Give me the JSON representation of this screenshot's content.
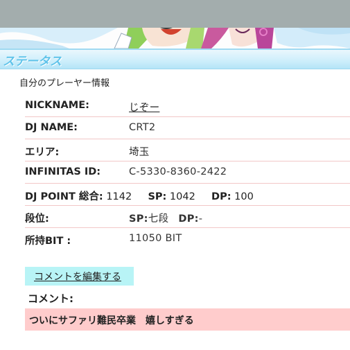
{
  "section": {
    "title": "ステータス"
  },
  "subtitle": "自分のプレーヤー情報",
  "profile": {
    "nickname_label": "NICKNAME:",
    "nickname": "じぞー",
    "dj_name_label": "DJ NAME:",
    "dj_name": "CRT2",
    "area_label": "エリア:",
    "area": "埼玉",
    "infinitas_id_label": "INFINITAS ID:",
    "infinitas_id": "C-5330-8360-2422",
    "dj_point_label": "DJ POINT 総合:",
    "dj_point_total": "1142",
    "sp_label": "SP:",
    "sp_value": "1042",
    "dp_label": "DP:",
    "dp_value": "100",
    "dan_label": "段位:",
    "dan_sp_label": "SP:",
    "dan_sp_value": "七段",
    "dan_dp_label": "DP:",
    "dan_dp_value": "-",
    "bit_label": "所持BIT :",
    "bit_value": "11050 BIT"
  },
  "comment": {
    "edit_button": "コメントを編集する",
    "label": "コメント:",
    "text": "ついにサファリ難民卒業　嬉しすぎる"
  },
  "colors": {
    "topbar": "#a3adad",
    "header_text": "#5fc3ea",
    "row_divider": "#f2c7c7",
    "edit_button_bg": "#b8f4f6",
    "comment_bg": "#ffcccc"
  }
}
